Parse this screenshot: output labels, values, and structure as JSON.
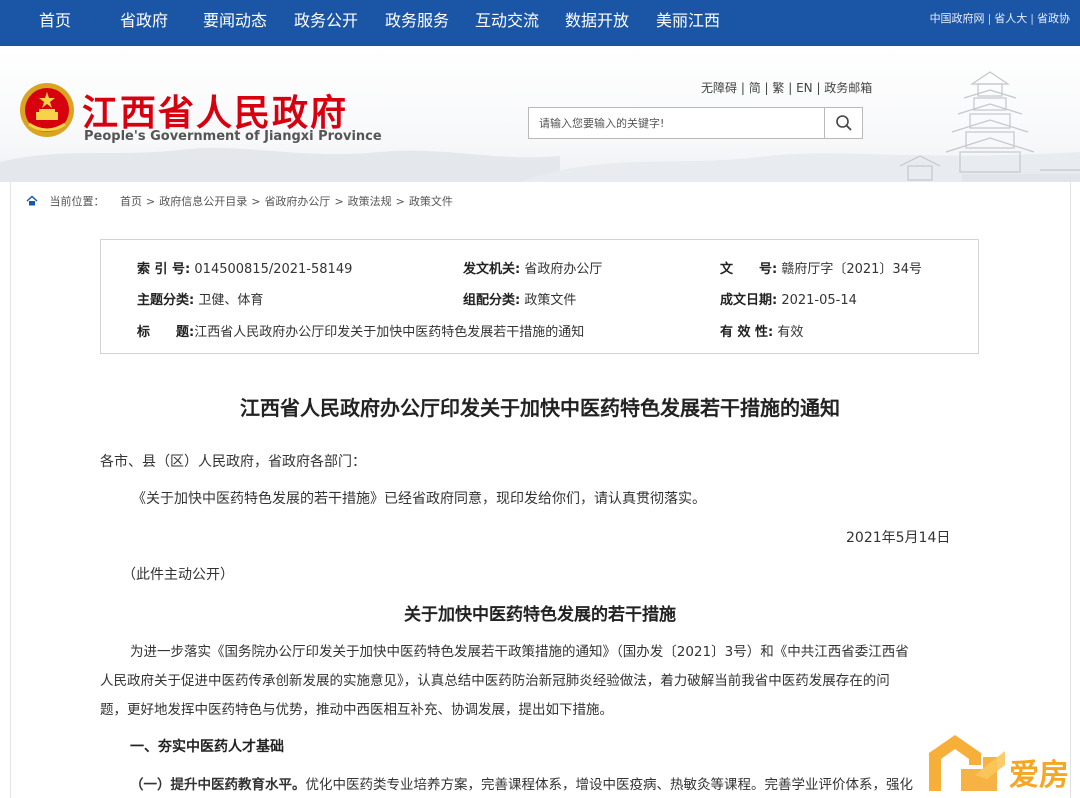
{
  "nav": {
    "items": [
      "首页",
      "省政府",
      "要闻动态",
      "政务公开",
      "政务服务",
      "互动交流",
      "数据开放",
      "美丽江西"
    ],
    "top_links": [
      "中国政府网",
      "省人大",
      "省政协"
    ]
  },
  "header": {
    "title": "江西省人民政府",
    "subtitle": "People's Government of Jiangxi Province",
    "util_links": [
      "无障碍",
      "简",
      "繁",
      "EN",
      "政务邮箱"
    ],
    "search_placeholder": "请输入您要输入的关键字!"
  },
  "breadcrumb": {
    "label": "当前位置：",
    "items": [
      "首页",
      "政府信息公开目录",
      "省政府办公厅",
      "政策法规",
      "政策文件"
    ]
  },
  "meta": {
    "index_key": "索 引 号:",
    "index_val": "014500815/2021-58149",
    "issuer_key": "发文机关:",
    "issuer_val": "省政府办公厅",
    "docno_key": "文　　号:",
    "docno_val": "赣府厅字〔2021〕34号",
    "topic_key": "主题分类:",
    "topic_val": "卫健、体育",
    "category_key": "组配分类:",
    "category_val": "政策文件",
    "date_key": "成文日期:",
    "date_val": "2021-05-14",
    "title_key": "标　　题:",
    "title_val": "江西省人民政府办公厅印发关于加快中医药特色发展若干措施的通知",
    "validity_key": "有 效 性:",
    "validity_val": "有效"
  },
  "article": {
    "title": "江西省人民政府办公厅印发关于加快中医药特色发展若干措施的通知",
    "salutation": "各市、县（区）人民政府，省政府各部门：",
    "body": "《关于加快中医药特色发展的若干措施》已经省政府同意，现印发给你们，请认真贯彻落实。",
    "date": "2021年5月14日",
    "disclosure": "（此件主动公开）",
    "subtitle": "关于加快中医药特色发展的若干措施",
    "intro_lines": [
      "为进一步落实《国务院办公厅印发关于加快中医药特色发展若干政策措施的通知》（国办发〔2021〕3号）和《中共江西省委江西省",
      "人民政府关于促进中医药传承创新发展的实施意见》，认真总结中医药防治新冠肺炎经验做法，着力破解当前我省中医药发展存在的问",
      "题，更好地发挥中医药特色与优势，推动中西医相互补充、协调发展，提出如下措施。"
    ],
    "section1": "一、夯实中医药人才基础",
    "item1_label": "（一）提升中医药教育水平。",
    "item1_text": "优化中医药类专业培养方案，完善课程体系，增设中医疫病、热敏灸等课程。完善学业评价体系，强化"
  },
  "watermark": {
    "text": "爱房"
  },
  "colors": {
    "nav_bg": "#1b56a6",
    "title_red": "#d7000f",
    "watermark_orange": "#f5a623"
  }
}
